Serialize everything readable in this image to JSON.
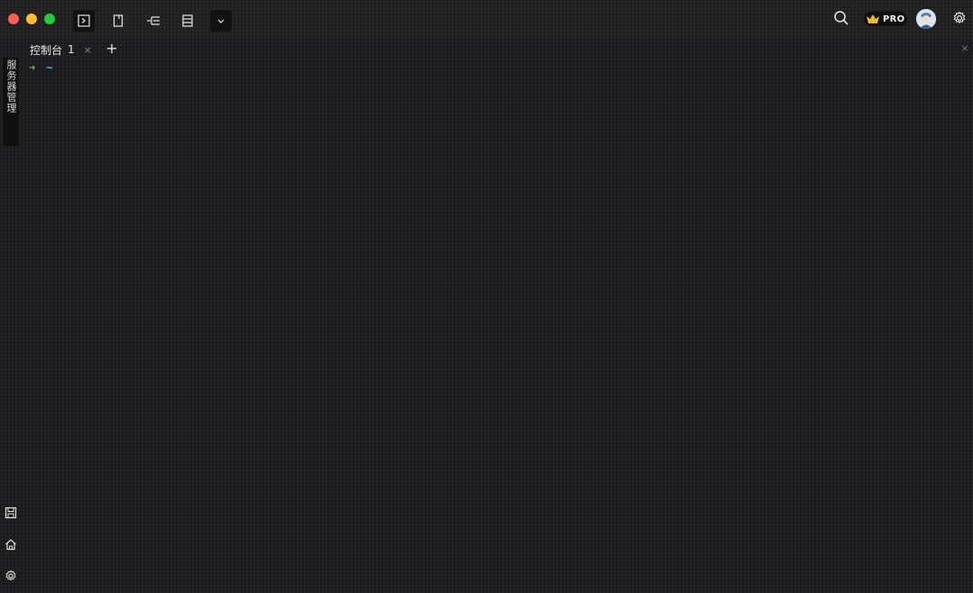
{
  "window": {
    "controls": [
      "close",
      "minimize",
      "maximize"
    ],
    "colors": {
      "close": "#fe5f57",
      "minimize": "#febc2e",
      "maximize": "#28c840"
    }
  },
  "toolbar": {
    "left_icons": [
      "terminal-icon",
      "file-icon",
      "tree-icon",
      "list-icon",
      "chevron-down-icon"
    ],
    "right": {
      "search_icon": "search-icon",
      "pro_label": "PRO",
      "settings_icon": "gear-icon"
    }
  },
  "sidebar": {
    "tab_label": "服务器管理",
    "bottom_icons": [
      "save-icon",
      "home-icon",
      "gear-icon"
    ]
  },
  "tabs": [
    {
      "label": "控制台",
      "number": "1",
      "close": "×"
    }
  ],
  "tab_add": "+",
  "panel_close": "×",
  "terminal": {
    "prompt_arrow": "➜",
    "prompt_dir": "~",
    "colors": {
      "arrow": "#4ec94e",
      "dir": "#3fc1d9"
    }
  }
}
